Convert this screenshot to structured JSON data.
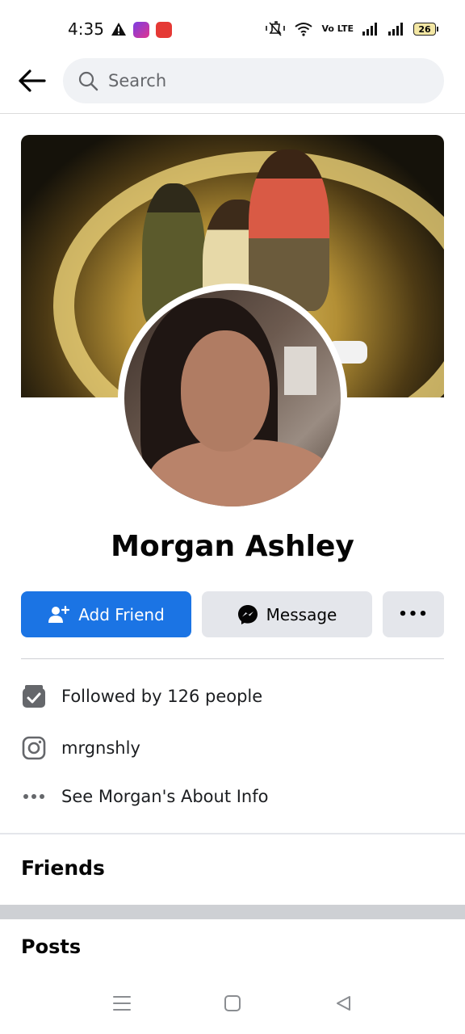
{
  "status_bar": {
    "time": "4:35",
    "network_label": "Vo LTE",
    "battery": "26"
  },
  "search": {
    "placeholder": "Search"
  },
  "profile": {
    "name": "Morgan Ashley"
  },
  "actions": {
    "add_friend": "Add Friend",
    "message": "Message",
    "more": "•••"
  },
  "details": {
    "followed_by": "Followed by 126 people",
    "instagram": "mrgnshly",
    "about": "See Morgan's About Info"
  },
  "sections": {
    "friends": "Friends",
    "posts": "Posts"
  },
  "colors": {
    "primary": "#1b74e4",
    "secondary_button": "#e4e6eb",
    "search_bg": "#f0f2f5"
  }
}
